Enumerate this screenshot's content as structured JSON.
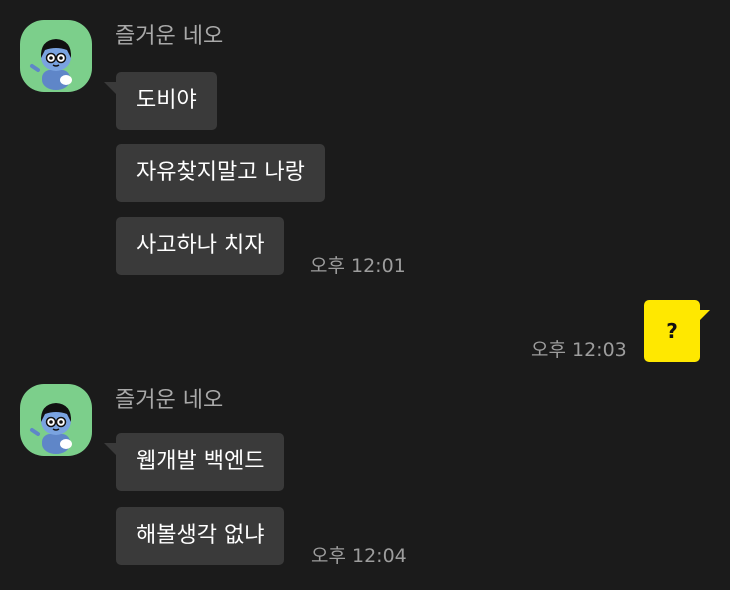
{
  "groups": [
    {
      "sender": "즐거운 네오",
      "avatar_icon": "neo-character-avatar-icon",
      "messages": [
        "도비야",
        "자유찾지말고 나랑",
        "사고하나 치자"
      ],
      "time": "오후 12:01"
    },
    {
      "sender": "즐거운 네오",
      "avatar_icon": "neo-character-avatar-icon",
      "messages": [
        "웹개발 백엔드",
        "해볼생각 없냐"
      ],
      "time": "오후 12:04"
    }
  ],
  "my_message": {
    "text": "?",
    "time": "오후 12:03"
  },
  "colors": {
    "background": "#1b1b1b",
    "incoming_bubble": "#3a3a3a",
    "outgoing_bubble": "#ffe800",
    "avatar_bg": "#7ccf8b",
    "sender_text": "#a9a9a9",
    "time_text": "#9d9d9d"
  }
}
